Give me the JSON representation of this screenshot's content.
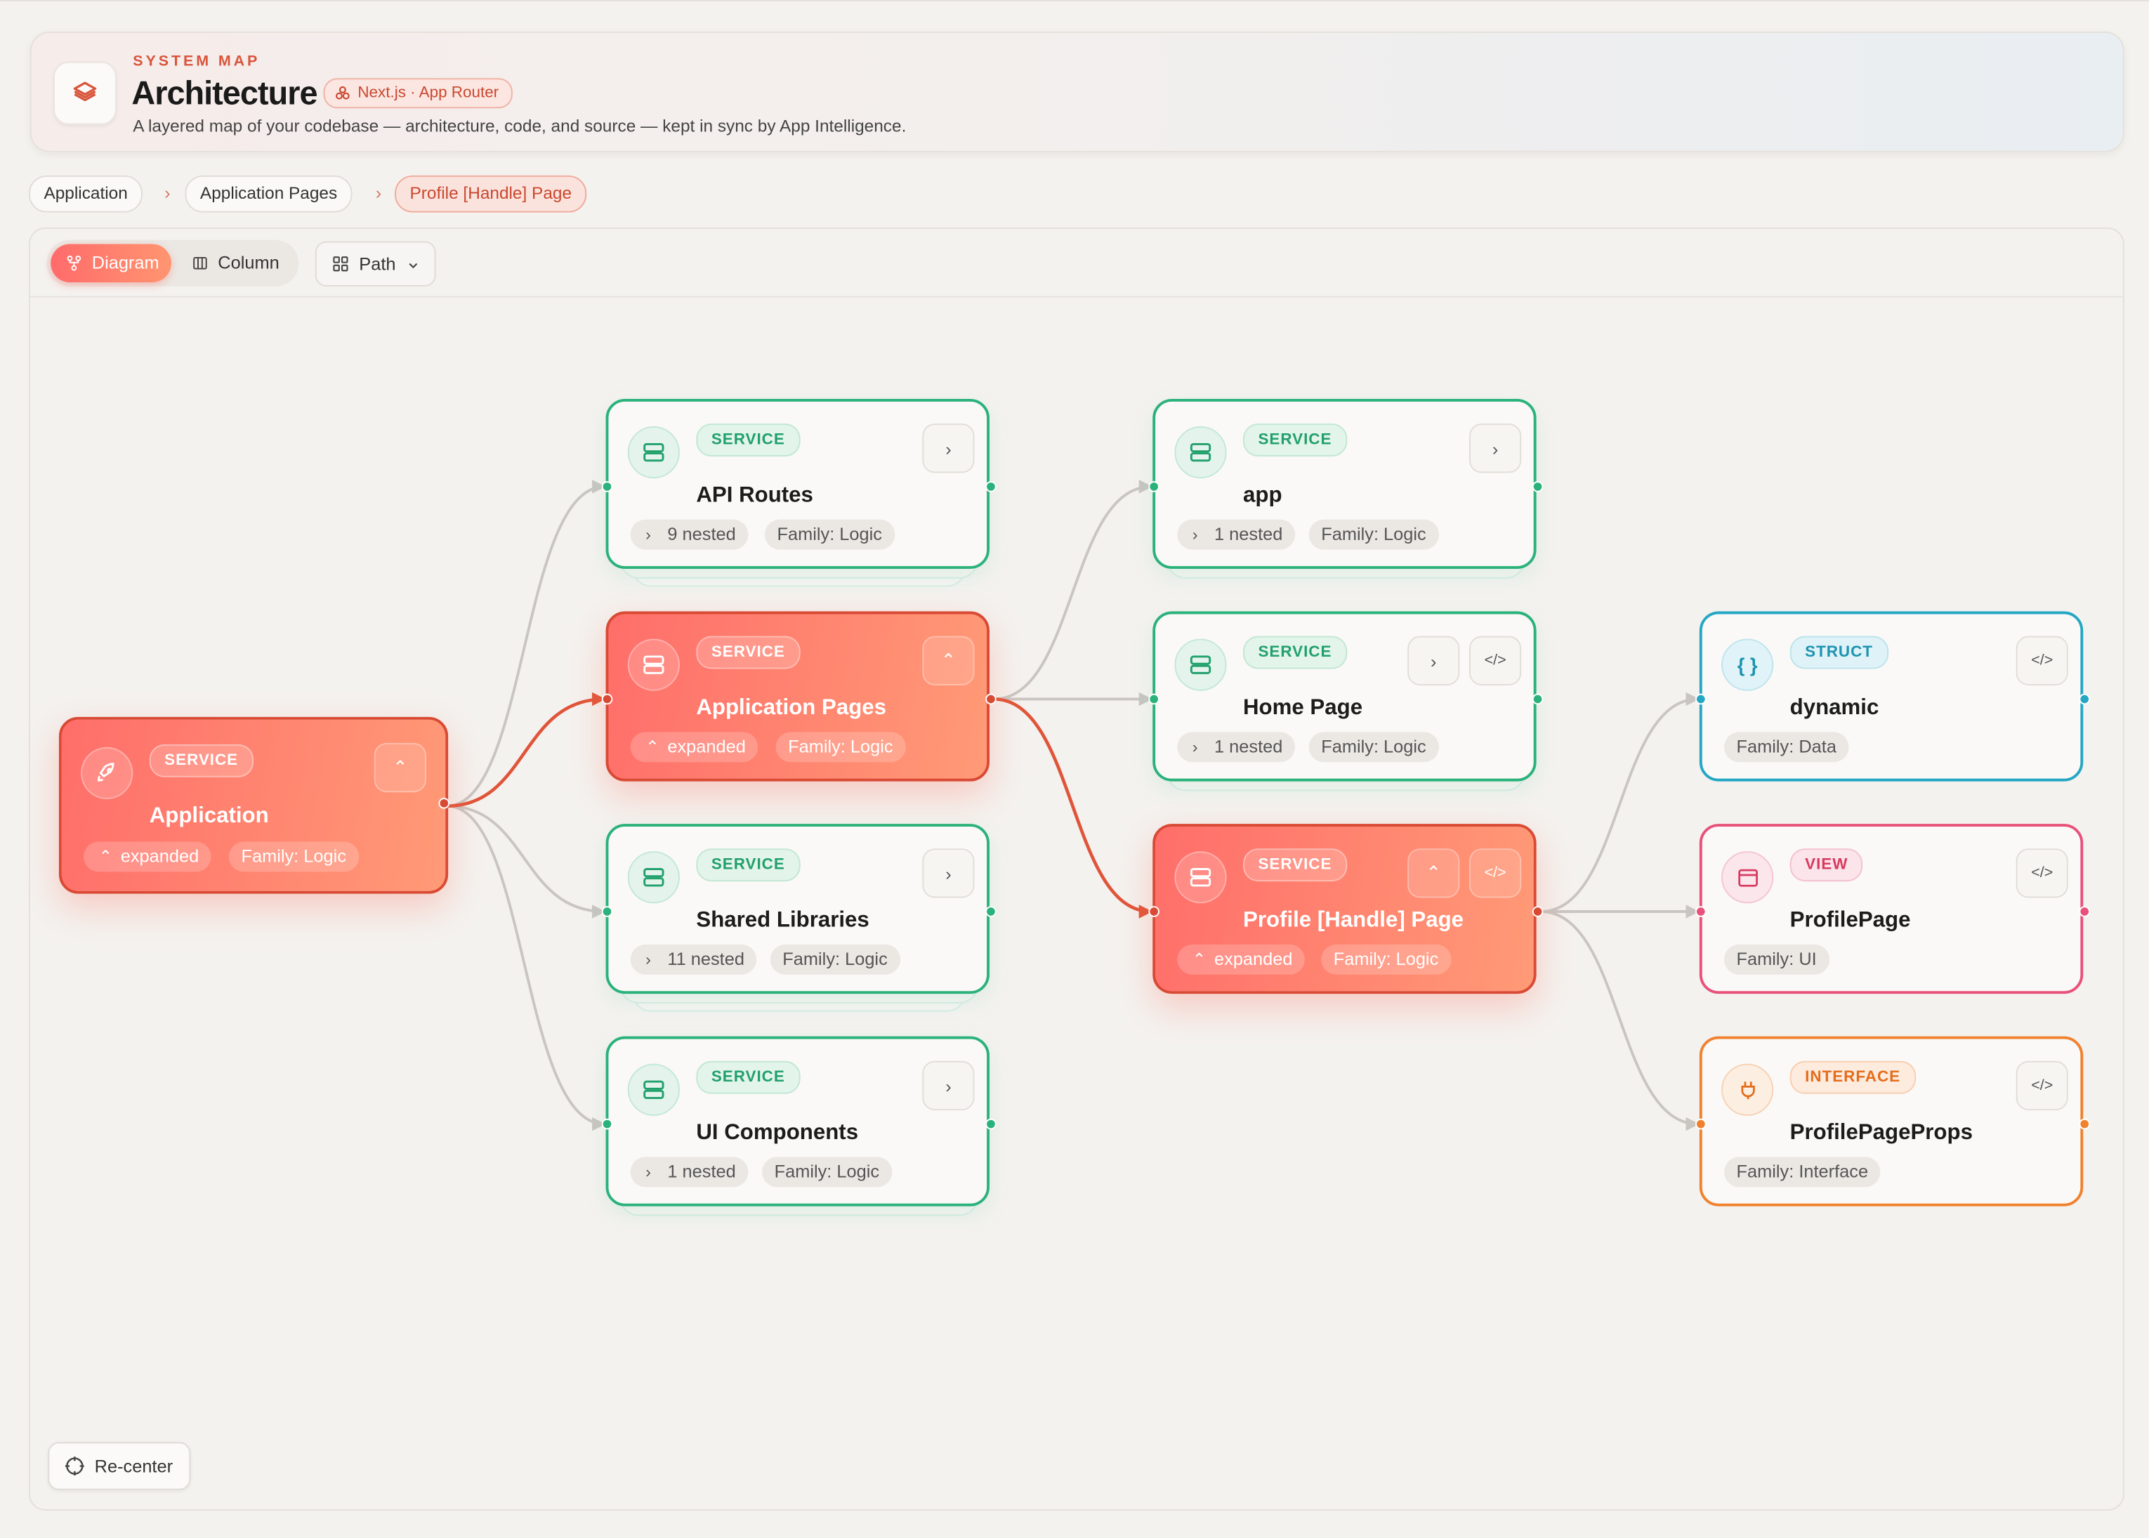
{
  "header": {
    "eyebrow": "SYSTEM MAP",
    "title": "Architecture",
    "framework_badge": "Next.js · App Router",
    "subtitle": "A layered map of your codebase — architecture, code, and source — kept in sync by App Intelligence."
  },
  "breadcrumbs": [
    "Application",
    "Application Pages",
    "Profile [Handle] Page"
  ],
  "toolbar": {
    "view_diagram": "Diagram",
    "view_column": "Column",
    "path_label": "Path"
  },
  "recenter_label": "Re-center",
  "nodes": {
    "application": {
      "kind": "SERVICE",
      "title": "Application",
      "state": "expanded",
      "family": "Family: Logic"
    },
    "api_routes": {
      "kind": "SERVICE",
      "title": "API Routes",
      "nested": "9 nested",
      "family": "Family: Logic"
    },
    "app_pages": {
      "kind": "SERVICE",
      "title": "Application Pages",
      "state": "expanded",
      "family": "Family: Logic"
    },
    "shared_libs": {
      "kind": "SERVICE",
      "title": "Shared Libraries",
      "nested": "11 nested",
      "family": "Family: Logic"
    },
    "ui_components": {
      "kind": "SERVICE",
      "title": "UI Components",
      "nested": "1 nested",
      "family": "Family: Logic"
    },
    "app": {
      "kind": "SERVICE",
      "title": "app",
      "nested": "1 nested",
      "family": "Family: Logic"
    },
    "home_page": {
      "kind": "SERVICE",
      "title": "Home Page",
      "nested": "1 nested",
      "family": "Family: Logic"
    },
    "profile_page_svc": {
      "kind": "SERVICE",
      "title": "Profile [Handle] Page",
      "state": "expanded",
      "family": "Family: Logic"
    },
    "dynamic": {
      "kind": "STRUCT",
      "title": "dynamic",
      "family": "Family: Data"
    },
    "profile_page": {
      "kind": "VIEW",
      "title": "ProfilePage",
      "family": "Family: UI"
    },
    "profile_page_props": {
      "kind": "INTERFACE",
      "title": "ProfilePageProps",
      "family": "Family: Interface"
    }
  },
  "colors": {
    "accent": "#ff6e6a",
    "service": "#2bb27b",
    "struct": "#25a7c4",
    "view": "#e8527a",
    "interface": "#f0822f",
    "active_edge": "#e0553a",
    "inactive_edge": "#c9c6c2"
  }
}
